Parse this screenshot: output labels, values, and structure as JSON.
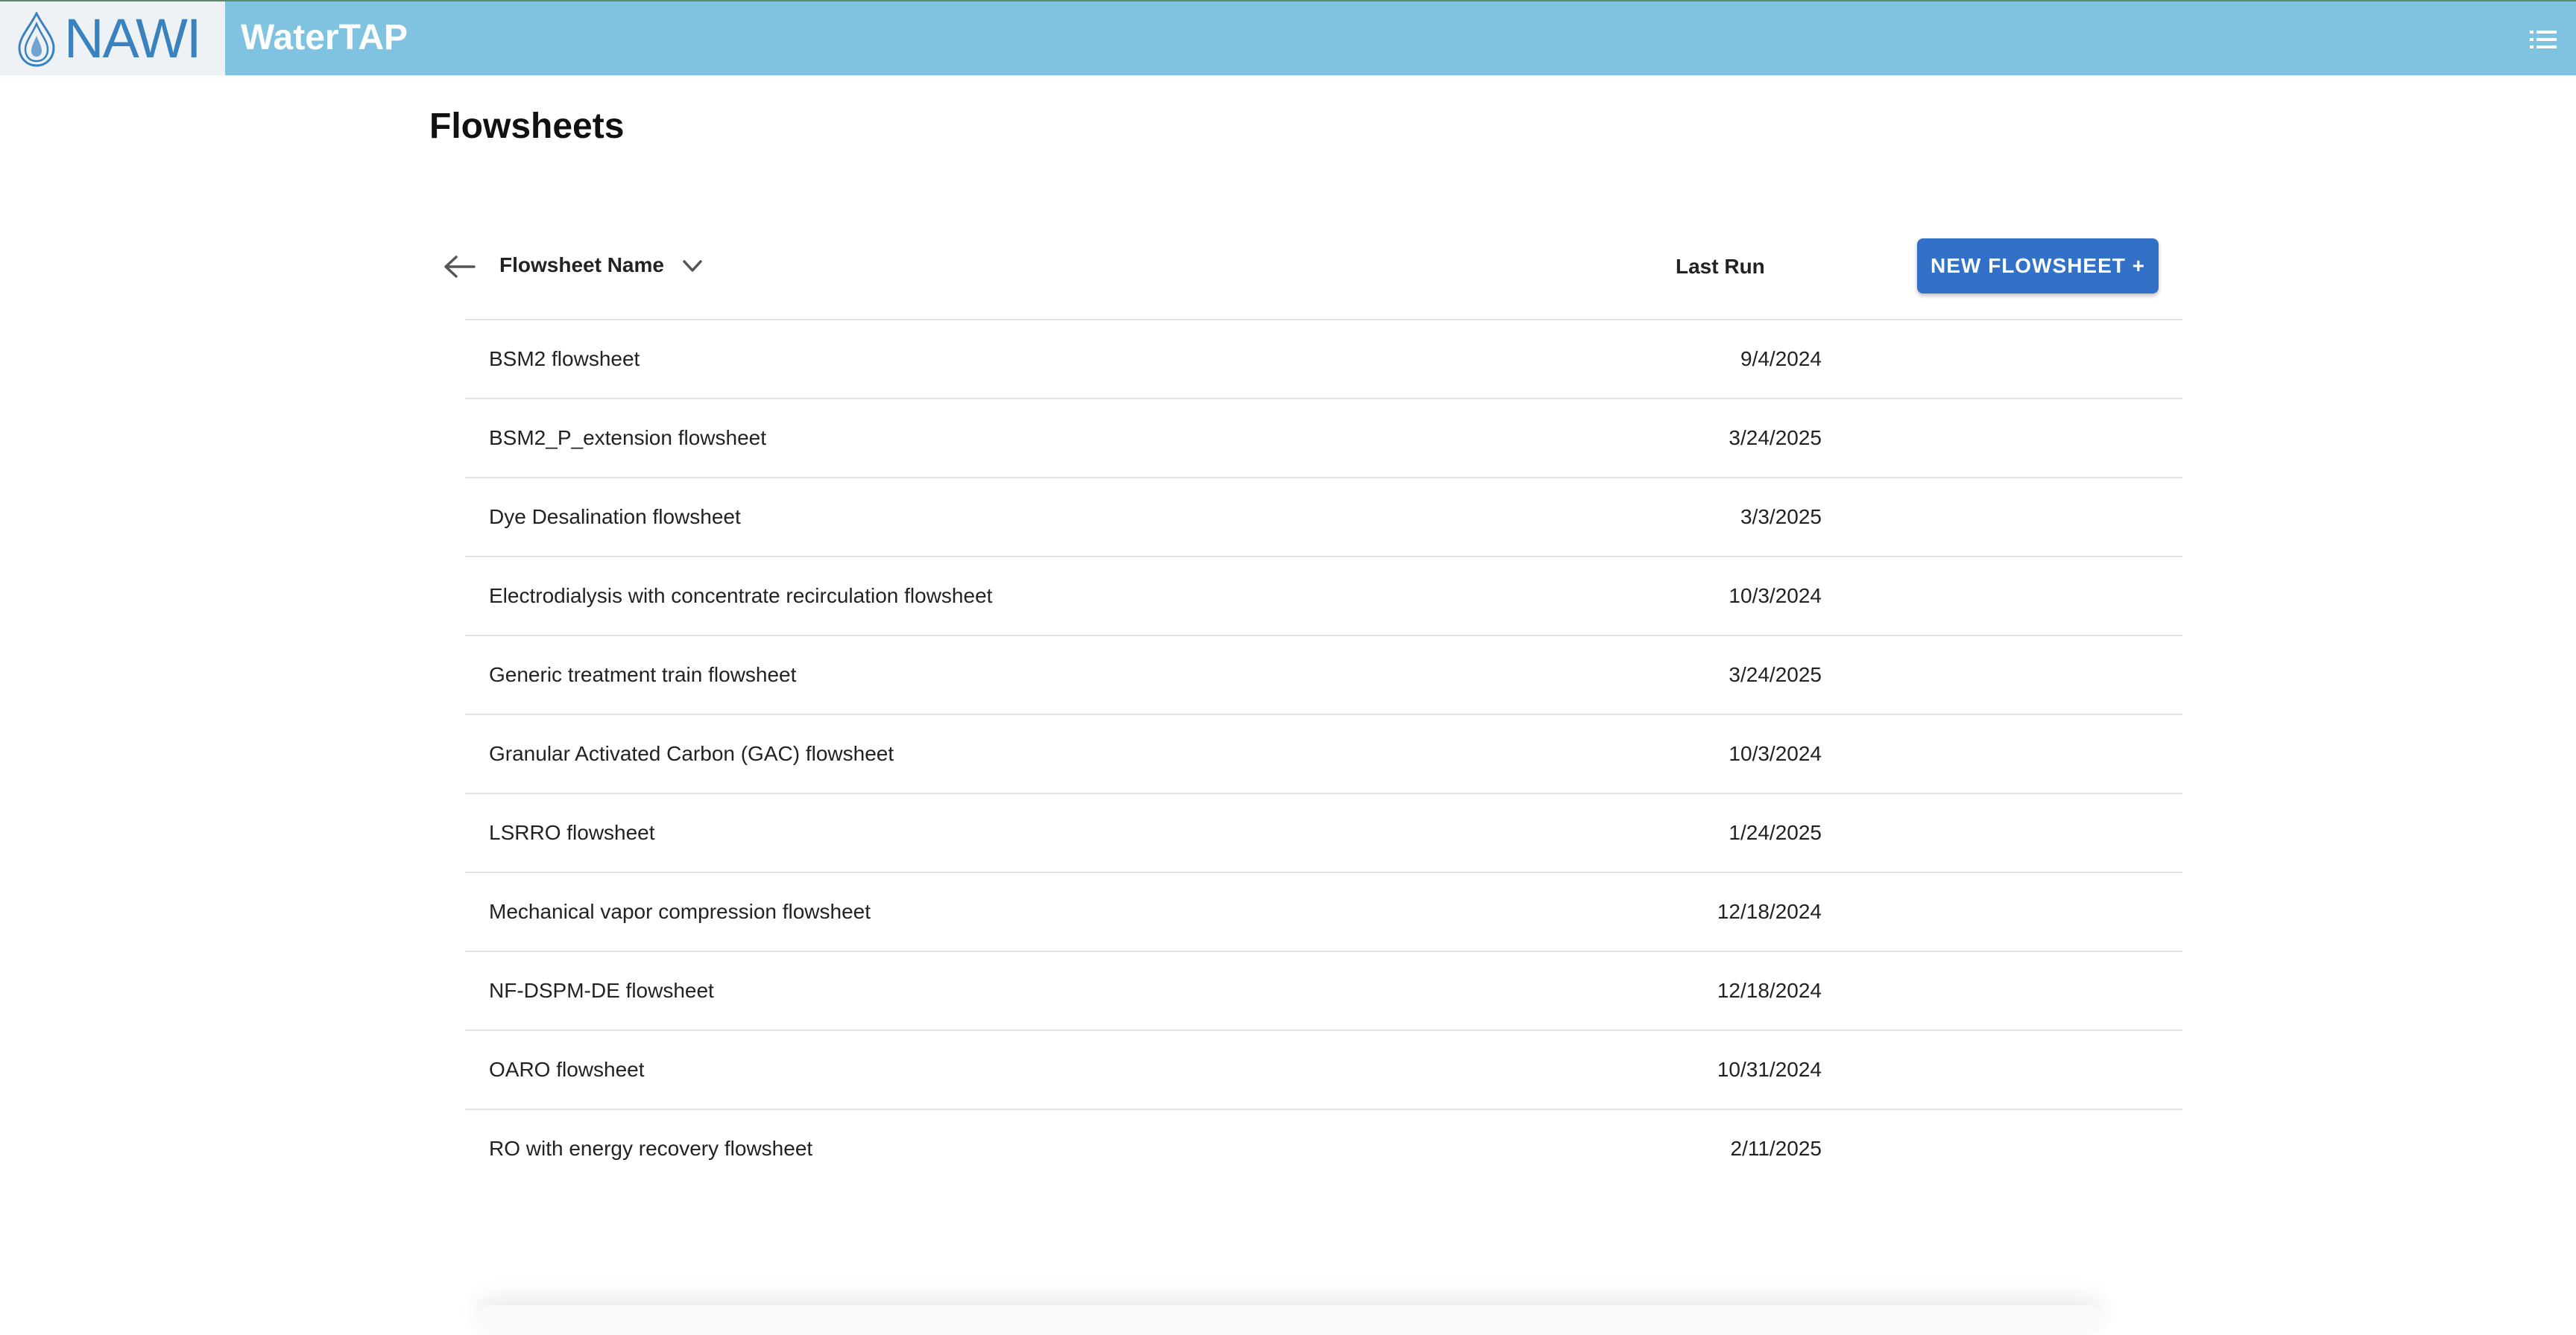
{
  "header": {
    "logo_text": "NAWI",
    "app_title": "WaterTAP",
    "menu_icon": "list-icon",
    "colors": {
      "bar": "#7fc3e1",
      "logo": "#3a82bf"
    }
  },
  "page": {
    "title": "Flowsheets"
  },
  "table": {
    "back_icon": "arrow-left-icon",
    "name_header": "Flowsheet Name",
    "sort_icon": "chevron-down-icon",
    "last_run_header": "Last Run",
    "new_button_label": "NEW FLOWSHEET +",
    "button_color": "#3370c8",
    "rows": [
      {
        "name": "BSM2 flowsheet",
        "last_run": "9/4/2024"
      },
      {
        "name": "BSM2_P_extension flowsheet",
        "last_run": "3/24/2025"
      },
      {
        "name": "Dye Desalination flowsheet",
        "last_run": "3/3/2025"
      },
      {
        "name": "Electrodialysis with concentrate recirculation flowsheet",
        "last_run": "10/3/2024"
      },
      {
        "name": "Generic treatment train flowsheet",
        "last_run": "3/24/2025"
      },
      {
        "name": "Granular Activated Carbon (GAC) flowsheet",
        "last_run": "10/3/2024"
      },
      {
        "name": "LSRRO flowsheet",
        "last_run": "1/24/2025"
      },
      {
        "name": "Mechanical vapor compression flowsheet",
        "last_run": "12/18/2024"
      },
      {
        "name": "NF-DSPM-DE flowsheet",
        "last_run": "12/18/2024"
      },
      {
        "name": "OARO flowsheet",
        "last_run": "10/31/2024"
      },
      {
        "name": "RO with energy recovery flowsheet",
        "last_run": "2/11/2025"
      }
    ]
  }
}
